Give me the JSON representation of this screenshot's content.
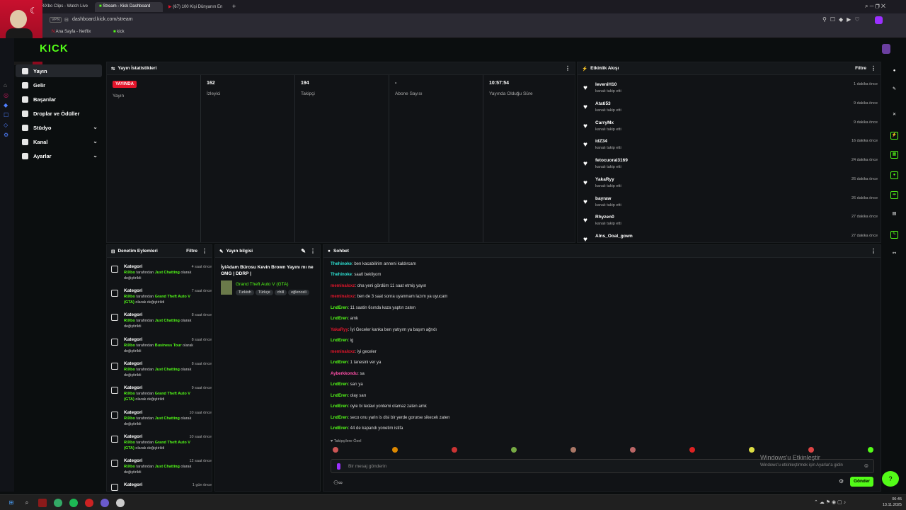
{
  "browser": {
    "tabs": [
      "RiXbo Clips - Watch Live",
      "Stream - Kick Dashboard",
      "(67) 100 Kişi Dünyanın En"
    ],
    "vpn": "VPN",
    "url": "dashboard.kick.com/stream",
    "bookmarks": [
      "Ana Sayfa - Netflix",
      "kick"
    ]
  },
  "logo": "KICK",
  "sidebar": {
    "items": [
      {
        "label": "Yayın",
        "icon": "broadcast-icon"
      },
      {
        "label": "Gelir",
        "icon": "money-icon"
      },
      {
        "label": "Başarılar",
        "icon": "trophy-icon"
      },
      {
        "label": "Droplar ve Ödüller",
        "icon": "gift-icon"
      },
      {
        "label": "Stüdyo",
        "icon": "studio-icon"
      },
      {
        "label": "Kanal",
        "icon": "channel-icon"
      },
      {
        "label": "Ayarlar",
        "icon": "settings-icon"
      }
    ]
  },
  "stats": {
    "title": "Yayın İstatistikleri",
    "items": [
      {
        "value": "YAYINDA",
        "label": "Yayın"
      },
      {
        "value": "162",
        "label": "İzleyici"
      },
      {
        "value": "194",
        "label": "Takipçi"
      },
      {
        "value": "-",
        "label": "Abone Sayısı"
      },
      {
        "value": "10:57:54",
        "label": "Yayında Olduğu Süre"
      }
    ]
  },
  "activity": {
    "title": "Etkinlik Akışı",
    "filter": "Filtre",
    "sub": "kanalı takip etti",
    "events": [
      {
        "name": "leveniH10",
        "time": "1 dakika önce"
      },
      {
        "name": "Atati53",
        "time": "9 dakika önce"
      },
      {
        "name": "CarryMx",
        "time": "9 dakika önce"
      },
      {
        "name": "idZ34",
        "time": "16 dakika önce"
      },
      {
        "name": "fetocuoral3169",
        "time": "24 dakika önce"
      },
      {
        "name": "YakaRyy",
        "time": "26 dakika önce"
      },
      {
        "name": "bayraw",
        "time": "26 dakika önce"
      },
      {
        "name": "Rhyzen0",
        "time": "27 dakika önce"
      },
      {
        "name": "Alns_Ooal_gown",
        "time": "27 dakika önce"
      }
    ]
  },
  "moderation": {
    "title": "Denetim Eylemleri",
    "filter": "Filtre",
    "items": [
      {
        "kategori": "Kategori",
        "time": "4 saat önce",
        "user": "RiXbo",
        "mid": " tarafından ",
        "cat": "Just Chatting",
        "end": " olarak değiştirildi"
      },
      {
        "kategori": "Kategori",
        "time": "7 saat önce",
        "user": "RiXbo",
        "mid": " tarafından ",
        "cat": "Grand Theft Auto V (GTA)",
        "end": " olarak değiştirildi"
      },
      {
        "kategori": "Kategori",
        "time": "8 saat önce",
        "user": "RiXbo",
        "mid": " tarafından ",
        "cat": "Just Chatting",
        "end": " olarak değiştirildi"
      },
      {
        "kategori": "Kategori",
        "time": "8 saat önce",
        "user": "RiXbo",
        "mid": " tarafından ",
        "cat": "Business Tour",
        "end": " olarak değiştirildi"
      },
      {
        "kategori": "Kategori",
        "time": "8 saat önce",
        "user": "RiXbo",
        "mid": " tarafından ",
        "cat": "Just Chatting",
        "end": " olarak değiştirildi"
      },
      {
        "kategori": "Kategori",
        "time": "9 saat önce",
        "user": "RiXbo",
        "mid": " tarafından ",
        "cat": "Grand Theft Auto V (GTA)",
        "end": " olarak değiştirildi"
      },
      {
        "kategori": "Kategori",
        "time": "10 saat önce",
        "user": "RiXbo",
        "mid": " tarafından ",
        "cat": "Just Chatting",
        "end": " olarak değiştirildi"
      },
      {
        "kategori": "Kategori",
        "time": "10 saat önce",
        "user": "RiXbo",
        "mid": " tarafından ",
        "cat": "Grand Theft Auto V (GTA)",
        "end": " olarak değiştirildi"
      },
      {
        "kategori": "Kategori",
        "time": "12 saat önce",
        "user": "RiXbo",
        "mid": " tarafından ",
        "cat": "Just Chatting",
        "end": " olarak değiştirildi"
      },
      {
        "kategori": "Kategori",
        "time": "1 gün önce",
        "user": "",
        "mid": "",
        "cat": "",
        "end": ""
      }
    ]
  },
  "info": {
    "title": "Yayın bilgisi",
    "stream_title": "İyiAdam Bürosu Kevin Brown Yayını mı ne OMG | DDRP |",
    "category": "Grand Theft Auto V (GTA)",
    "tags": [
      "Turkish",
      "Türkçe",
      "chill",
      "eğlenceli"
    ]
  },
  "chat": {
    "title": "Sohbet",
    "messages": [
      {
        "user": "Thehinoke",
        "color": "#2de0d2",
        "text": ": ben kacabilirim anneni kaldırcam"
      },
      {
        "user": "Thehinoke",
        "color": "#2de0d2",
        "text": ": saatl bekliyom"
      },
      {
        "user": "meminaloxz",
        "color": "#e4152b",
        "text": ": oha yeni gördüm 11 saat etmiş yayın"
      },
      {
        "user": "meminaloxz",
        "color": "#e4152b",
        "text": ": ben de 3 saat sonra uyanmam lazım ya uyucam"
      },
      {
        "user": "LndEren",
        "color": "#53fc18",
        "text": ": 11 saatin 6sında kaza yaptın zaten"
      },
      {
        "user": "LndEren",
        "color": "#53fc18",
        "text": ": amk"
      },
      {
        "user": "YakaRyy",
        "color": "#e4152b",
        "text": ": İyi Geceler kanka ben yatıyım ya başım ağrıdı"
      },
      {
        "user": "LndEren",
        "color": "#53fc18",
        "text": ": ig"
      },
      {
        "user": "meminaloxz",
        "color": "#e4152b",
        "text": ": iyi geceler"
      },
      {
        "user": "LndEren",
        "color": "#53fc18",
        "text": ": 1 tanesini ver ya"
      },
      {
        "user": "Ayberkkondu",
        "color": "#ff4fa8",
        "text": ": sa"
      },
      {
        "user": "LndEren",
        "color": "#53fc18",
        "text": ": sarı ya"
      },
      {
        "user": "LndEren",
        "color": "#53fc18",
        "text": ": olay sarı"
      },
      {
        "user": "LndEren",
        "color": "#53fc18",
        "text": ": oyle bi tedavi yontemi olamaz zaten amk"
      },
      {
        "user": "LndEren",
        "color": "#53fc18",
        "text": ": seco onu yarin is disi bir yerde gorurse sikecek zaten"
      },
      {
        "user": "LndEren",
        "color": "#53fc18",
        "text": ": 44 de kapandı yonetim istifa"
      }
    ],
    "follower_only": "Takipçilere Özel",
    "placeholder": "Bir mesaj gönderin",
    "send": "Gönder"
  },
  "windows": {
    "title": "Windows'u Etkinleştir",
    "sub": "Windows'u etkinleştirmek için Ayarlar'a gidin"
  },
  "clock": {
    "time": "06:45",
    "date": "13.11.2025"
  },
  "colors": {
    "accent": "#53fc18",
    "live": "#e4152b"
  }
}
